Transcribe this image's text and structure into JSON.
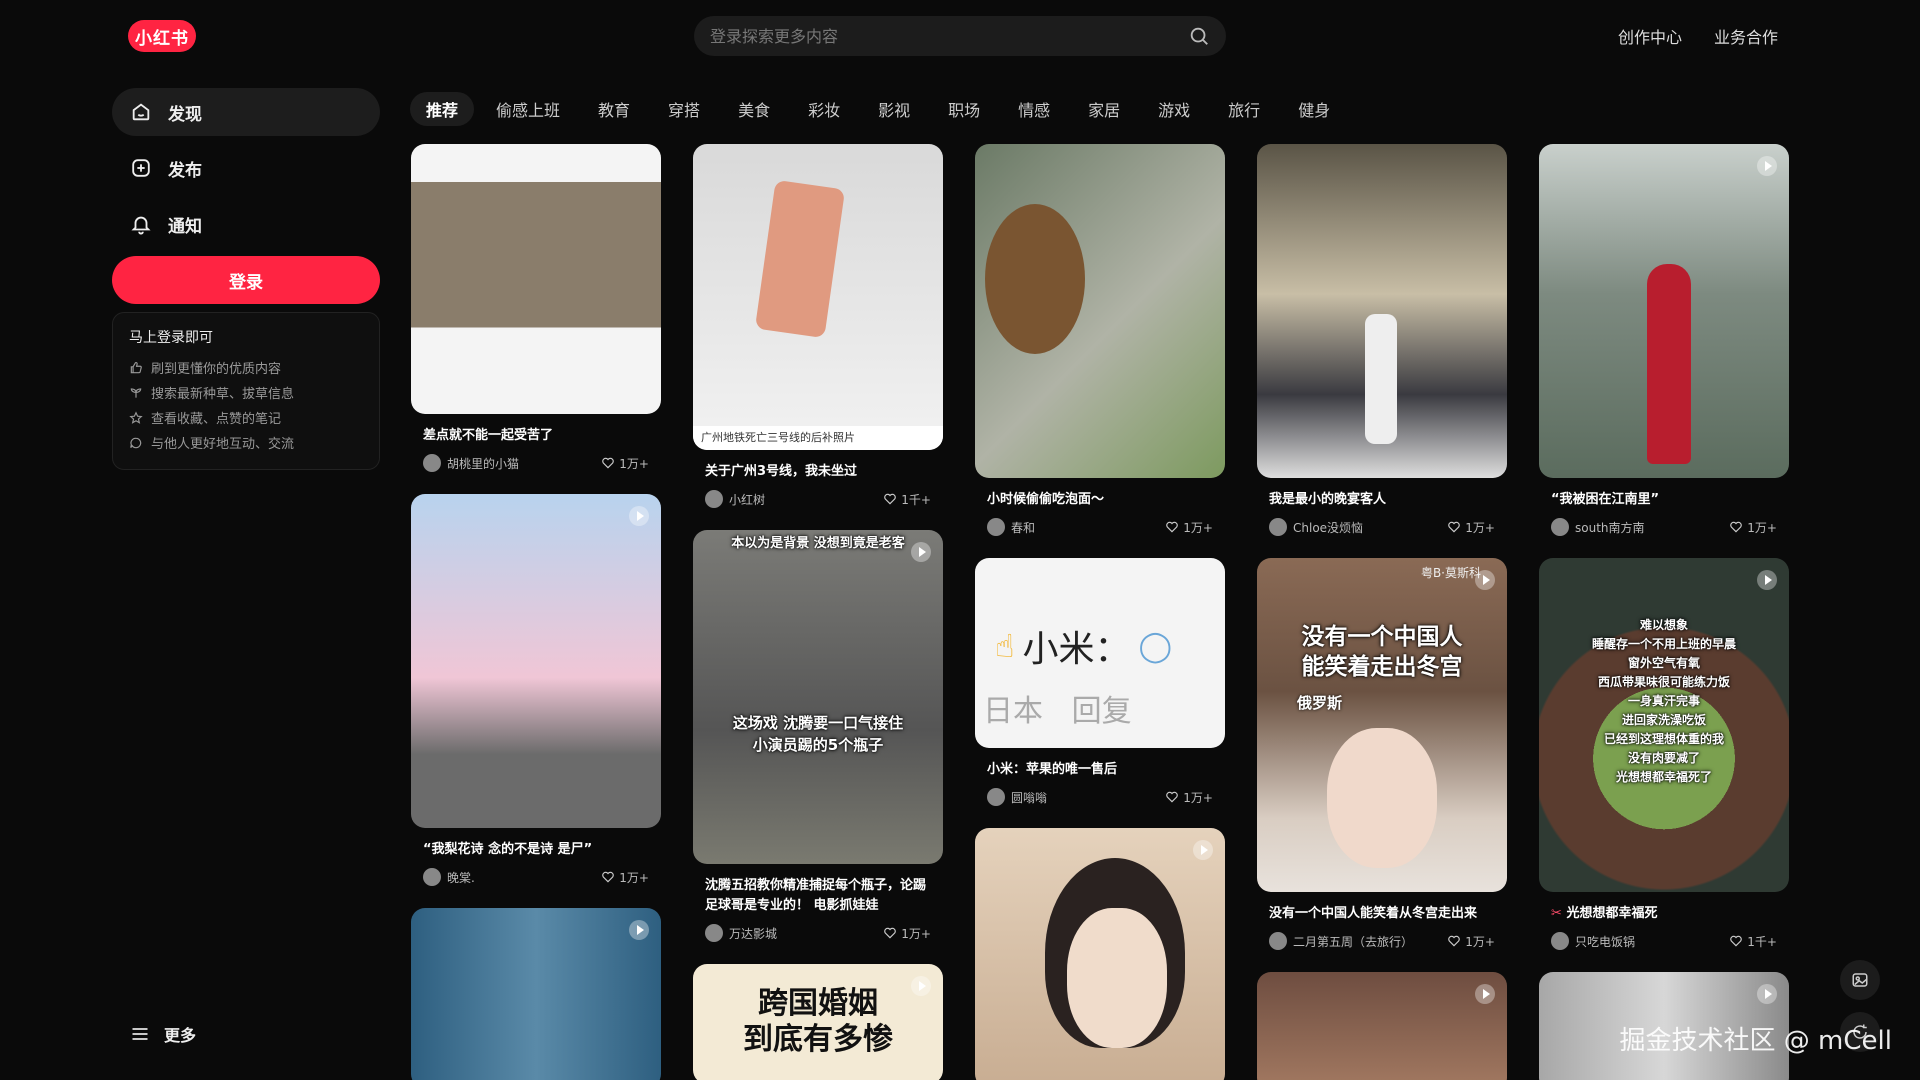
{
  "header": {
    "logo": "小红书",
    "search_placeholder": "登录探索更多内容",
    "links": [
      "创作中心",
      "业务合作"
    ]
  },
  "sidebar": {
    "items": [
      {
        "label": "发现",
        "icon": "home-icon",
        "active": true
      },
      {
        "label": "发布",
        "icon": "plus-square-icon",
        "active": false
      },
      {
        "label": "通知",
        "icon": "bell-icon",
        "active": false
      }
    ],
    "login_label": "登录",
    "login_card": {
      "title": "马上登录即可",
      "benefits": [
        "刷到更懂你的优质内容",
        "搜索最新种草、拔草信息",
        "查看收藏、点赞的笔记",
        "与他人更好地互动、交流"
      ]
    },
    "more_label": "更多"
  },
  "tabs": [
    "推荐",
    "偷感上班",
    "教育",
    "穿搭",
    "美食",
    "彩妆",
    "影视",
    "职场",
    "情感",
    "家居",
    "游戏",
    "旅行",
    "健身"
  ],
  "feed": {
    "columns": [
      [
        {
          "caption": "差点就不能一起受苦了",
          "author": "胡桃里的小猫",
          "likes": "1万+",
          "video": false,
          "bg": "#d7d2ca"
        },
        {
          "caption": "“我梨花诗 念的不是诗 是尸”",
          "author": "晚棠.",
          "likes": "1万+",
          "video": true,
          "bg": "#c8d9ec"
        },
        {
          "caption": "",
          "author": "",
          "likes": "",
          "video": true,
          "bg": "#3d6d8e"
        }
      ],
      [
        {
          "caption": "关于广州3号线，我未坐过",
          "author": "小红树",
          "likes": "1千+",
          "video": false,
          "bg": "#e6e6e6",
          "overlay": "广州地铁死亡三号线的后补照片"
        },
        {
          "caption": "沈腾五招教你精准捕捉每个瓶子，论踢足球哥是专业的！ 电影抓娃娃",
          "author": "万达影城",
          "likes": "1万+",
          "video": true,
          "bg": "#6a6a66",
          "overlay": "这场戏 沈腾要一口气接住\n小演员踢的5个瓶子",
          "overlay_top": "本以为是背景 没想到竟是老客"
        },
        {
          "caption": "",
          "author": "",
          "likes": "",
          "video": true,
          "bg": "#f2e9d4",
          "overlay": "跨国婚姻\n到底有多惨"
        }
      ],
      [
        {
          "caption": "小时候偷偷吃泡面～",
          "author": "春和",
          "likes": "1万+",
          "video": false,
          "bg": "#7f8a79"
        },
        {
          "caption": "小米：苹果的唯一售后",
          "author": "圆嗡嗡",
          "likes": "1万+",
          "video": false,
          "bg": "#f4f4f4",
          "overlay": "小米：",
          "overlay_sub": "日本   回复"
        },
        {
          "caption": "",
          "author": "",
          "likes": "",
          "video": true,
          "bg": "#d8c3ad"
        }
      ],
      [
        {
          "caption": "我是最小的晚宴客人",
          "author": "Chloe没烦恼",
          "likes": "1万+",
          "video": false,
          "bg": "#9b8f7c"
        },
        {
          "caption": "没有一个中国人能笑着从冬宫走出来",
          "author": "二月第五周（去旅行）",
          "likes": "1万+",
          "video": true,
          "bg": "#8a6b55",
          "overlay": "没有一个中国人\n能笑着走出冬宫",
          "overlay_sub": "俄罗斯",
          "corner": "粤B·莫斯科"
        },
        {
          "caption": "",
          "author": "",
          "likes": "",
          "video": true,
          "bg": "#7a5a4a"
        }
      ],
      [
        {
          "caption": "“我被困在江南里”",
          "author": "south南方南",
          "likes": "1万+",
          "video": true,
          "bg": "#8e9a8e"
        },
        {
          "caption": "光想想都幸福死",
          "author": "只吃电饭锅",
          "likes": "1千+",
          "video": true,
          "bg": "#5f6a55",
          "overlay": "难以想象\n睡醒存一个不用上班的早晨\n窗外空气有氧\n西瓜带果味很可能练力饭\n一身真汗完事\n进回家洗澡吃饭\n已经到这理想体重的我\n没有肉要减了\n光想想都幸福死了"
        },
        {
          "caption": "",
          "author": "",
          "likes": "",
          "video": true,
          "bg": "#9a9a9a"
        }
      ]
    ]
  },
  "watermark": "掘金技术社区 @ mCell"
}
